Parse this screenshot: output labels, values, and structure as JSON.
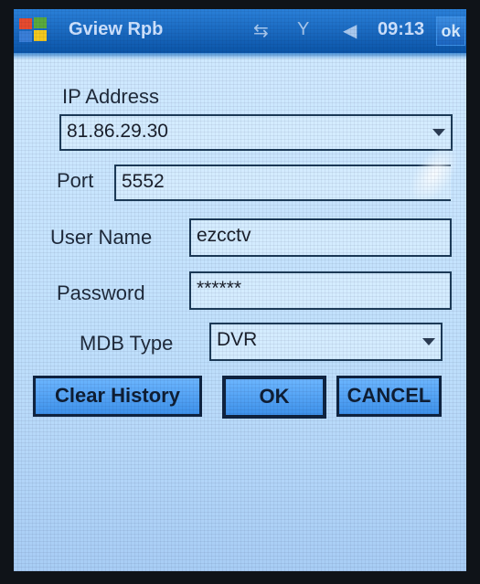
{
  "titlebar": {
    "app_title": "Gview Rpb",
    "time": "09:13",
    "ok_label": "ok",
    "icons": [
      "windows-start-icon",
      "sync-arrows-icon",
      "signal-antenna-icon",
      "speaker-icon"
    ]
  },
  "form": {
    "ip_label": "IP Address",
    "ip_value": "81.86.29.30",
    "port_label": "Port",
    "port_value": "5552",
    "username_label": "User Name",
    "username_value": "ezcctv",
    "password_label": "Password",
    "password_value": "******",
    "mdb_label": "MDB Type",
    "mdb_value": "DVR"
  },
  "buttons": {
    "clear_history": "Clear History",
    "ok": "OK",
    "cancel": "CANCEL"
  },
  "colors": {
    "titlebar": "#1061bb",
    "background": "#c7e5ff",
    "button": "#4f9ff0",
    "field": "#d4ecff"
  }
}
